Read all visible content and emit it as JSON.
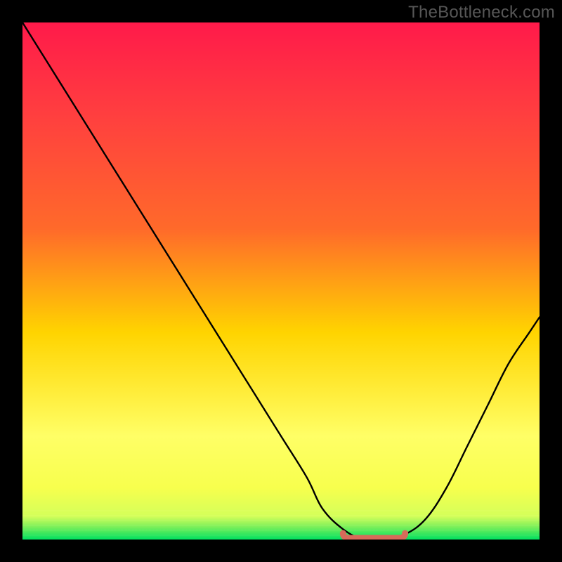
{
  "watermark": "TheBottleneck.com",
  "colors": {
    "frame": "#000000",
    "gradient_top": "#ff1a4a",
    "gradient_mid_upper": "#ff6a2a",
    "gradient_mid": "#ffd400",
    "gradient_lower": "#f7ff4d",
    "gradient_green": "#00e060",
    "curve": "#000000",
    "marker": "#d86a5a"
  },
  "chart_data": {
    "type": "line",
    "title": "",
    "xlabel": "",
    "ylabel": "",
    "xlim": [
      0,
      100
    ],
    "ylim": [
      0,
      100
    ],
    "x": [
      0,
      5,
      10,
      15,
      20,
      25,
      30,
      35,
      40,
      45,
      50,
      55,
      58,
      62,
      66,
      70,
      74,
      78,
      82,
      86,
      90,
      94,
      98,
      100
    ],
    "series": [
      {
        "name": "bottleneck-curve",
        "values": [
          100,
          92,
          84,
          76,
          68,
          60,
          52,
          44,
          36,
          28,
          20,
          12,
          6,
          2,
          0,
          0,
          1,
          4,
          10,
          18,
          26,
          34,
          40,
          43
        ]
      }
    ],
    "valley": {
      "x_start": 62,
      "x_end": 74,
      "y": 0
    }
  }
}
